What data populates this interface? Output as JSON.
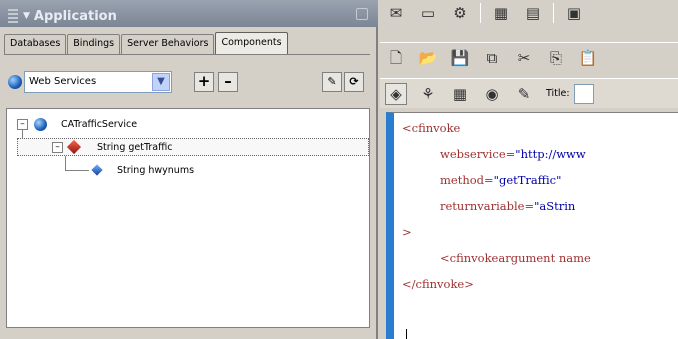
{
  "panel": {
    "title": "Application",
    "tabs": [
      "Databases",
      "Bindings",
      "Server Behaviors",
      "Components"
    ],
    "active_tab": "Components"
  },
  "web_services": {
    "selected": "Web Services",
    "plus_label": "+",
    "minus_label": "–"
  },
  "tree": {
    "service": "CATrafficService",
    "method": "String getTraffic",
    "argument": "String hwynums"
  },
  "editor": {
    "title_label": "Title:",
    "code": {
      "open_tag": "<cfinvoke",
      "webservice_attr": "webservice=",
      "webservice_val": "\"http://www",
      "method_attr": "method=",
      "method_val": "\"getTraffic\"",
      "return_attr": "returnvariable=",
      "return_val": "\"aStrin",
      "close_bracket": ">",
      "argument_tag": "<cfinvokeargument name",
      "end_tag": "</cfinvoke>"
    }
  },
  "colors": {
    "gutter": "#2a7ccf",
    "tag": "#a03030",
    "value": "#0000aa"
  }
}
